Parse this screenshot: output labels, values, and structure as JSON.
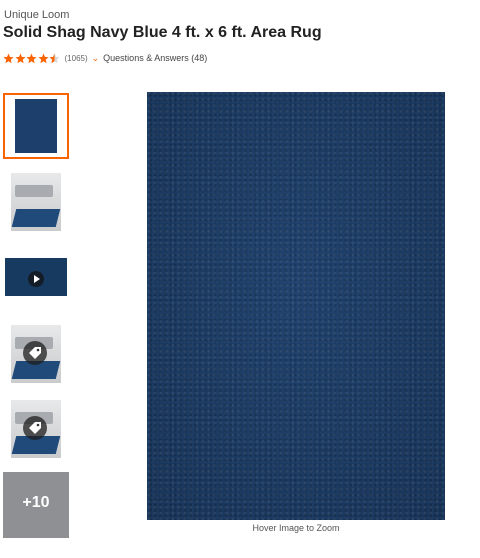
{
  "product": {
    "brand": "Unique Loom",
    "title": "Solid Shag Navy Blue 4 ft. x 6 ft. Area Rug",
    "rating": 4.5,
    "rating_max": 5,
    "review_count": "(1065)",
    "qa_label": "Questions & Answers (48)"
  },
  "colors": {
    "accent": "#f96302",
    "star": "#f96302",
    "rug": "#1c3d68"
  },
  "thumbnails": [
    {
      "kind": "rug",
      "selected": true
    },
    {
      "kind": "room",
      "selected": false
    },
    {
      "kind": "video",
      "selected": false,
      "icon": "play-icon"
    },
    {
      "kind": "room-tag",
      "selected": false,
      "icon": "tag-icon"
    },
    {
      "kind": "room-tag",
      "selected": false,
      "icon": "tag-icon"
    },
    {
      "kind": "more",
      "selected": false,
      "label": "+10"
    }
  ],
  "main_image": {
    "zoom_hint": "Hover Image to Zoom"
  }
}
